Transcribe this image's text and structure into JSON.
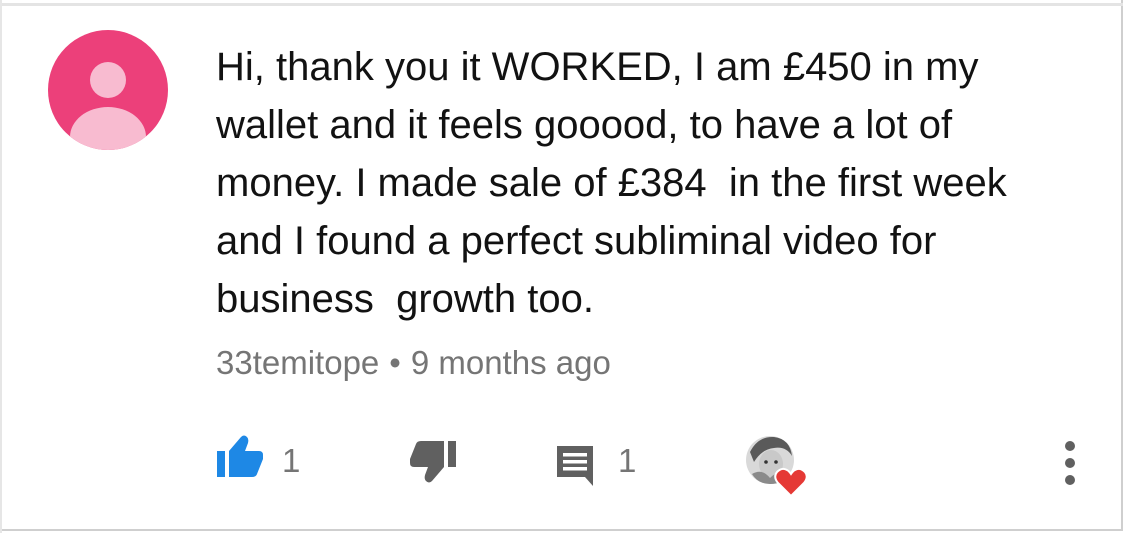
{
  "comment": {
    "text": "Hi, thank you it WORKED, I am £450 in my\nwallet and it feels gooood, to have a lot of\nmoney. I made sale of £384  in the first week\nand I found a perfect subliminal video for\nbusiness  growth too.",
    "author": "33temitope",
    "separator": "•",
    "time": "9 months ago"
  },
  "actions": {
    "like_count": "1",
    "reply_count": "1",
    "like_icon": "thumbs-up-icon",
    "dislike_icon": "thumbs-down-icon",
    "reply_icon": "comment-icon",
    "creator_heart_icon": "heart-icon",
    "more_icon": "more-vertical-icon"
  },
  "colors": {
    "avatar_bg": "#ec407a",
    "avatar_fg": "#f8bbd0",
    "like_active": "#1e88e5",
    "icon_gray": "#606060",
    "heart": "#e53935",
    "text": "#121212",
    "meta": "#757575"
  }
}
